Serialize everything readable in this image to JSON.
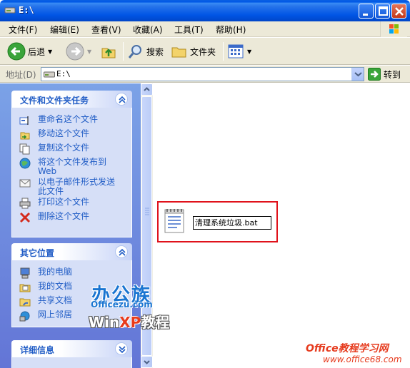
{
  "window": {
    "title": "E:\\"
  },
  "menu": [
    "文件(F)",
    "编辑(E)",
    "查看(V)",
    "收藏(A)",
    "工具(T)",
    "帮助(H)"
  ],
  "toolbar": {
    "back_label": "后退",
    "search_label": "搜索",
    "folders_label": "文件夹"
  },
  "address": {
    "label": "地址(D)",
    "value": "E:\\",
    "go_label": "转到"
  },
  "tasks_panel": {
    "title": "文件和文件夹任务",
    "items": [
      {
        "label": "重命名这个文件",
        "icon": "rename-icon"
      },
      {
        "label": "移动这个文件",
        "icon": "move-icon"
      },
      {
        "label": "复制这个文件",
        "icon": "copy-icon"
      },
      {
        "label": "将这个文件发布到 Web",
        "icon": "publish-web-icon"
      },
      {
        "label": "以电子邮件形式发送此文件",
        "icon": "email-icon"
      },
      {
        "label": "打印这个文件",
        "icon": "printer-icon"
      },
      {
        "label": "删除这个文件",
        "icon": "delete-icon"
      }
    ]
  },
  "places_panel": {
    "title": "其它位置",
    "items": [
      {
        "label": "我的电脑",
        "icon": "my-computer-icon"
      },
      {
        "label": "我的文档",
        "icon": "my-documents-icon"
      },
      {
        "label": "共享文档",
        "icon": "shared-documents-icon"
      },
      {
        "label": "网上邻居",
        "icon": "network-places-icon"
      }
    ]
  },
  "details_panel": {
    "title": "详细信息"
  },
  "file": {
    "name": "清理系统垃圾.bat",
    "icon": "batch-file-icon"
  },
  "watermarks": {
    "brand_cn": "办公族",
    "brand_url": "Officezu.com",
    "win_text": "Win",
    "xp_text": "XP",
    "tutorial_text": "教程",
    "site_name": "Office教程学习网",
    "site_url": "www.office68.com"
  },
  "colors": {
    "title_bar": "#0055e5",
    "task_pane": "#7ba2e7",
    "link": "#215dc6",
    "highlight_border": "#e0121b"
  }
}
